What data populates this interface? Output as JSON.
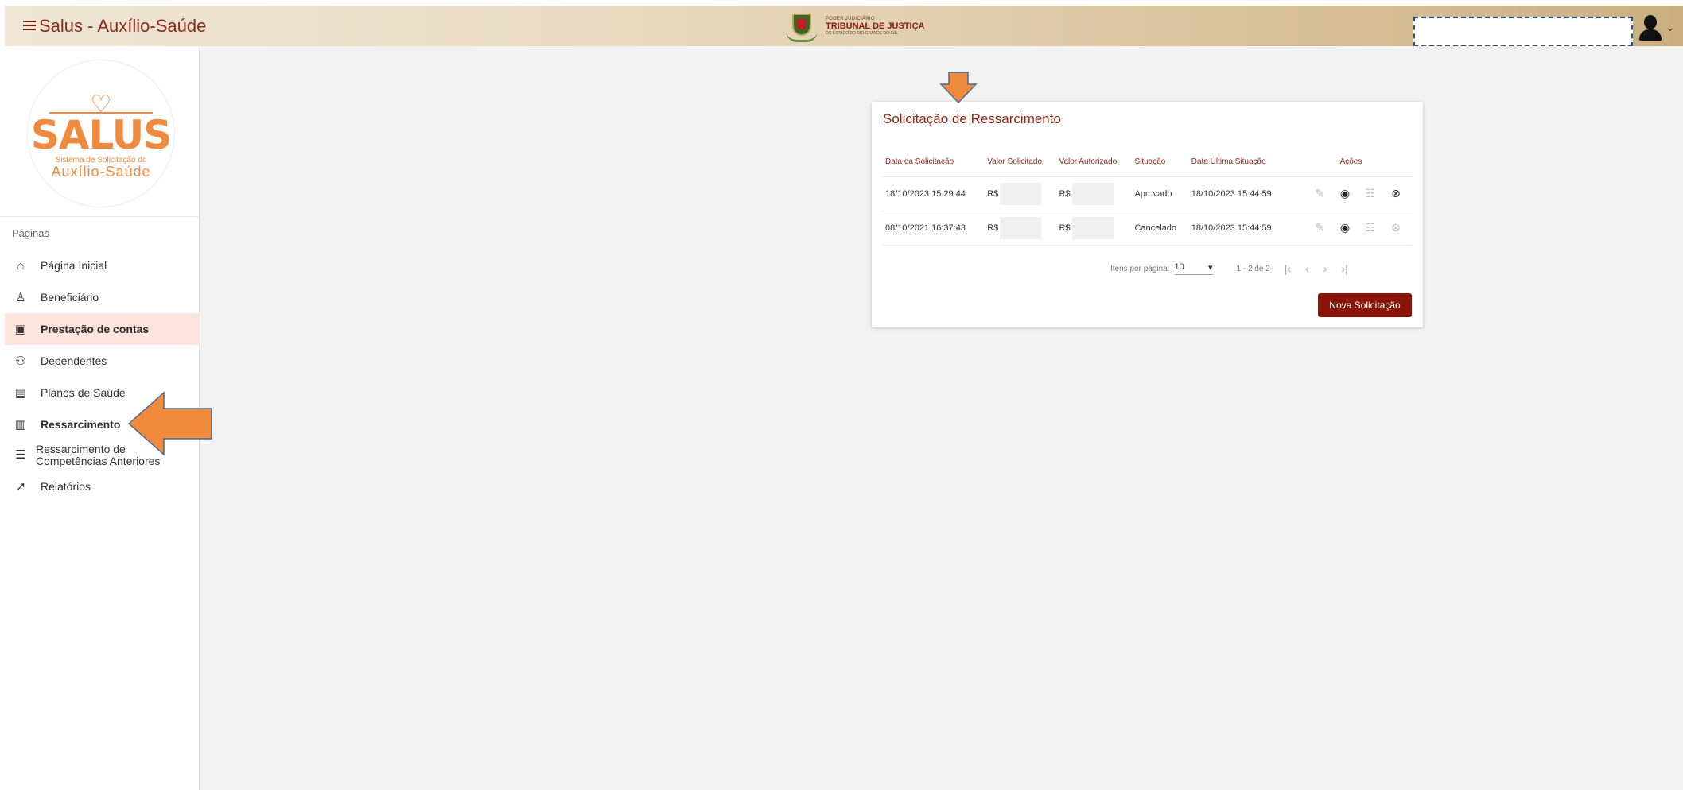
{
  "header": {
    "title": "Salus - Auxílio-Saúde",
    "org_small": "PODER JUDICIÁRIO",
    "org_name": "TRIBUNAL DE JUSTIÇA",
    "org_state": "DO ESTADO DO RIO GRANDE DO SUL",
    "search_placeholder": ""
  },
  "sidebar": {
    "logo": {
      "word": "SALUS",
      "sub1": "Sistema de Solicitação do",
      "sub2": "Auxílio-Saúde"
    },
    "section_label": "Páginas",
    "items": [
      {
        "label": "Página Inicial",
        "icon": "home-icon"
      },
      {
        "label": "Beneficiário",
        "icon": "person-icon"
      },
      {
        "label": "Prestação de contas",
        "icon": "calendar-icon"
      },
      {
        "label": "Dependentes",
        "icon": "people-icon"
      },
      {
        "label": "Planos de Saúde",
        "icon": "clipboard-icon"
      },
      {
        "label": "Ressarcimento",
        "icon": "receipt-icon"
      },
      {
        "label": "Ressarcimento de Competências Anteriores",
        "icon": "list-icon"
      },
      {
        "label": "Relatórios",
        "icon": "chart-icon"
      }
    ]
  },
  "card": {
    "title": "Solicitação de Ressarcimento",
    "columns": [
      "Data da Solicitação",
      "Valor Solicitado",
      "Valor Autorizado",
      "Situação",
      "Data Última Situação",
      "Ações"
    ],
    "rows": [
      {
        "data": "18/10/2023 15:29:44",
        "solicitado": "R$",
        "autorizado": "R$",
        "situacao": "Aprovado",
        "ultima": "18/10/2023 15:44:59"
      },
      {
        "data": "08/10/2021 16:37:43",
        "solicitado": "R$",
        "autorizado": "R$",
        "situacao": "Cancelado",
        "ultima": "18/10/2023 15:44:59"
      }
    ],
    "paginator": {
      "items_label": "Itens por página:",
      "page_size": "10",
      "range": "1 - 2 de 2"
    },
    "new_button": "Nova Solicitação"
  },
  "colors": {
    "accent": "#8a2a1a",
    "button": "#8a1408",
    "logo_orange": "#f08a3c",
    "active_bg": "#fde4dc",
    "arrow": "#f08a3c"
  }
}
